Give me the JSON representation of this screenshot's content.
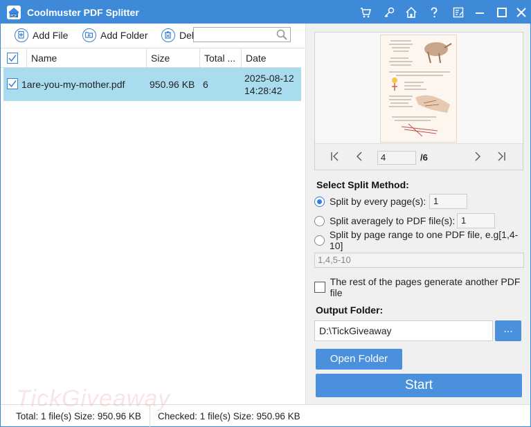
{
  "app": {
    "title": "Coolmuster PDF Splitter"
  },
  "titlebar_icons": [
    "cart-icon",
    "key-icon",
    "home-icon",
    "help-icon",
    "feedback-icon",
    "minimize-icon",
    "maximize-icon",
    "close-icon"
  ],
  "toolbar": {
    "add_file": "Add File",
    "add_folder": "Add Folder",
    "delete": "Del",
    "search_placeholder": ""
  },
  "table": {
    "headers": {
      "name": "Name",
      "size": "Size",
      "total": "Total ...",
      "date": "Date"
    },
    "rows": [
      {
        "name": "1are-you-my-mother.pdf",
        "size": "950.96 KB",
        "total": "6",
        "date": "2025-08-12",
        "time": "14:28:42",
        "checked": true
      }
    ]
  },
  "preview": {
    "current_page": "4",
    "total_pages": "/6"
  },
  "split": {
    "section_label": "Select Split Method:",
    "option_every": "Split by every page(s):",
    "option_every_value": "1",
    "option_average": "Split averagely to PDF file(s):",
    "option_average_value": "1",
    "option_range": "Split by page range to one PDF file, e.g[1,4-10]",
    "range_placeholder": "1,4,5-10",
    "rest_pages": "The rest of the pages generate another PDF file",
    "selected": "every"
  },
  "output": {
    "label": "Output Folder:",
    "path": "D:\\TickGiveaway",
    "browse": "...",
    "open_folder": "Open Folder",
    "start": "Start"
  },
  "status": {
    "total": "Total: 1 file(s) Size: 950.96 KB",
    "checked": "Checked: 1 file(s) Size: 950.96 KB"
  },
  "watermark": "TickGiveaway",
  "colors": {
    "titlebar": "#3f8ad8",
    "accent": "#4a90dd",
    "selected_row": "#a8dcee"
  }
}
